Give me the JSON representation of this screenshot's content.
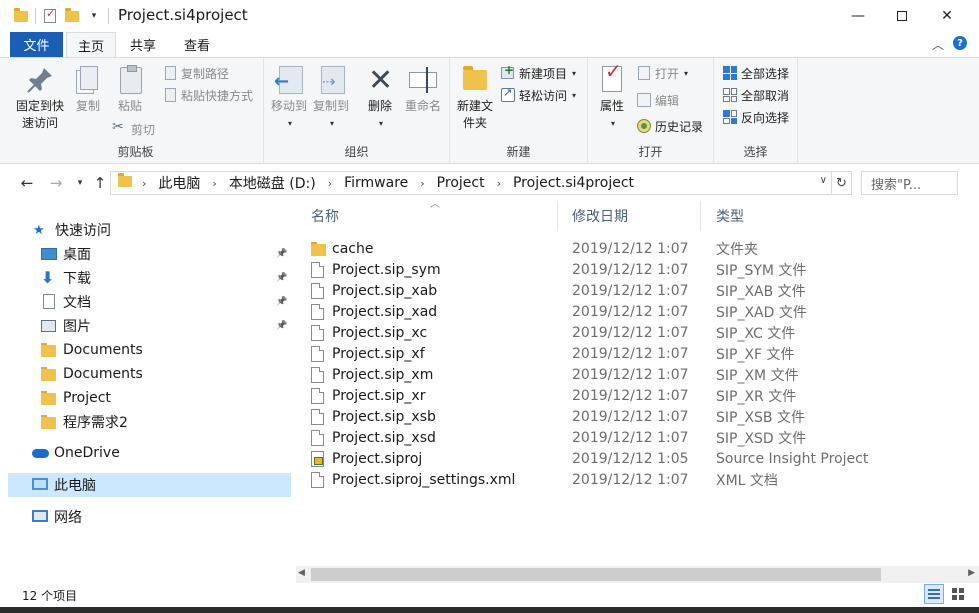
{
  "window": {
    "title": "Project.si4project"
  },
  "ribbon_tabs": {
    "file": "文件",
    "home": "主页",
    "share": "共享",
    "view": "查看"
  },
  "ribbon": {
    "clipboard": {
      "group_label": "剪贴板",
      "pin": "固定到快速访问",
      "copy": "复制",
      "paste": "粘贴",
      "copy_path": "复制路径",
      "paste_shortcut": "粘贴快捷方式",
      "cut": "剪切"
    },
    "organize": {
      "group_label": "组织",
      "move_to": "移动到",
      "copy_to": "复制到",
      "delete": "删除",
      "rename": "重命名"
    },
    "new": {
      "group_label": "新建",
      "new_folder": "新建文件夹",
      "new_item": "新建项目",
      "easy_access": "轻松访问"
    },
    "open": {
      "group_label": "打开",
      "properties": "属性",
      "open": "打开",
      "edit": "编辑",
      "history": "历史记录"
    },
    "select": {
      "group_label": "选择",
      "select_all": "全部选择",
      "select_none": "全部取消",
      "invert": "反向选择"
    }
  },
  "address": {
    "crumbs": [
      "此电脑",
      "本地磁盘 (D:)",
      "Firmware",
      "Project",
      "Project.si4project"
    ],
    "search_placeholder": "搜索\"P..."
  },
  "nav": {
    "quick_access": "快速访问",
    "items": [
      {
        "label": "桌面",
        "icon": "desktop-icon",
        "pinned": true
      },
      {
        "label": "下载",
        "icon": "download-icon",
        "pinned": true
      },
      {
        "label": "文档",
        "icon": "documents-icon",
        "pinned": true
      },
      {
        "label": "图片",
        "icon": "pictures-icon",
        "pinned": true
      },
      {
        "label": "Documents",
        "icon": "folder-icon",
        "pinned": false
      },
      {
        "label": "Documents",
        "icon": "folder-icon",
        "pinned": false
      },
      {
        "label": "Project",
        "icon": "folder-icon",
        "pinned": false
      },
      {
        "label": "程序需求2",
        "icon": "folder-icon",
        "pinned": false
      }
    ],
    "onedrive": "OneDrive",
    "this_pc": "此电脑",
    "network": "网络"
  },
  "columns": {
    "name": "名称",
    "date": "修改日期",
    "type": "类型"
  },
  "files": [
    {
      "name": "cache",
      "date": "2019/12/12 1:07",
      "type": "文件夹",
      "kind": "folder"
    },
    {
      "name": "Project.sip_sym",
      "date": "2019/12/12 1:07",
      "type": "SIP_SYM 文件",
      "kind": "file"
    },
    {
      "name": "Project.sip_xab",
      "date": "2019/12/12 1:07",
      "type": "SIP_XAB 文件",
      "kind": "file"
    },
    {
      "name": "Project.sip_xad",
      "date": "2019/12/12 1:07",
      "type": "SIP_XAD 文件",
      "kind": "file"
    },
    {
      "name": "Project.sip_xc",
      "date": "2019/12/12 1:07",
      "type": "SIP_XC 文件",
      "kind": "file"
    },
    {
      "name": "Project.sip_xf",
      "date": "2019/12/12 1:07",
      "type": "SIP_XF 文件",
      "kind": "file"
    },
    {
      "name": "Project.sip_xm",
      "date": "2019/12/12 1:07",
      "type": "SIP_XM 文件",
      "kind": "file"
    },
    {
      "name": "Project.sip_xr",
      "date": "2019/12/12 1:07",
      "type": "SIP_XR 文件",
      "kind": "file"
    },
    {
      "name": "Project.sip_xsb",
      "date": "2019/12/12 1:07",
      "type": "SIP_XSB 文件",
      "kind": "file"
    },
    {
      "name": "Project.sip_xsd",
      "date": "2019/12/12 1:07",
      "type": "SIP_XSD 文件",
      "kind": "file"
    },
    {
      "name": "Project.siproj",
      "date": "2019/12/12 1:05",
      "type": "Source Insight Project",
      "kind": "si"
    },
    {
      "name": "Project.siproj_settings.xml",
      "date": "2019/12/12 1:07",
      "type": "XML 文档",
      "kind": "file"
    }
  ],
  "status": {
    "item_count": "12 个项目"
  },
  "colors": {
    "file_tab": "#1a5fb4",
    "selection": "#cce8ff",
    "folder": "#f0c14b"
  }
}
